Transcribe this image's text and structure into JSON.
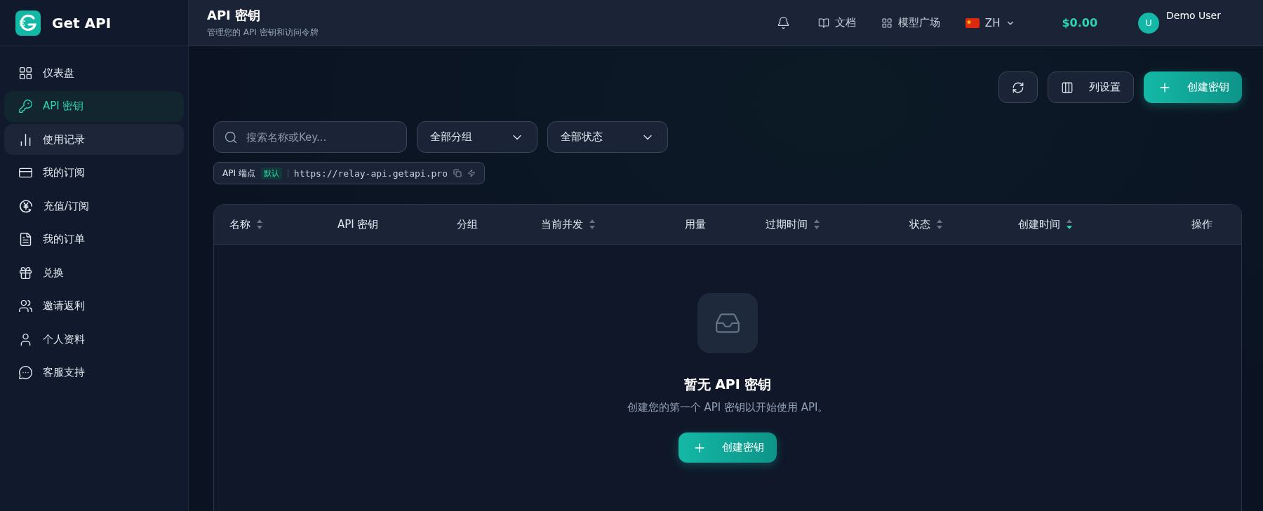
{
  "brand": {
    "name": "Get API"
  },
  "sidebar": {
    "items": [
      {
        "label": "仪表盘",
        "selected": false,
        "hovered": false
      },
      {
        "label": "API 密钥",
        "selected": true,
        "hovered": false
      },
      {
        "label": "使用记录",
        "selected": false,
        "hovered": true
      },
      {
        "label": "我的订阅",
        "selected": false,
        "hovered": false
      },
      {
        "label": "充值/订阅",
        "selected": false,
        "hovered": false
      },
      {
        "label": "我的订单",
        "selected": false,
        "hovered": false
      },
      {
        "label": "兑换",
        "selected": false,
        "hovered": false
      },
      {
        "label": "邀请返利",
        "selected": false,
        "hovered": false
      },
      {
        "label": "个人资料",
        "selected": false,
        "hovered": false
      },
      {
        "label": "客服支持",
        "selected": false,
        "hovered": false
      }
    ]
  },
  "header": {
    "title": "API 密钥",
    "subtitle": "管理您的 API 密钥和访问令牌",
    "links": [
      "文档",
      "模型广场"
    ],
    "language": "ZH",
    "balance": "$0.00",
    "user": {
      "initial": "U",
      "name": "Demo User"
    }
  },
  "toolbar": {
    "buttons": [
      {
        "kind": "refresh"
      },
      {
        "kind": "columns",
        "label": "列设置"
      },
      {
        "kind": "create",
        "label": "创建密钥"
      }
    ]
  },
  "filters": {
    "search": {
      "placeholder": "搜索名称或Key..."
    },
    "selects": [
      "全部分组",
      "全部状态"
    ]
  },
  "endpoint": {
    "label": "API 端点",
    "badge": "默认",
    "url": "https://relay-api.getapi.pro"
  },
  "table": {
    "columns": [
      {
        "label": "名称",
        "sortable": true,
        "sort_active": false
      },
      {
        "label": "API 密钥"
      },
      {
        "label": "分组"
      },
      {
        "label": "当前并发",
        "sortable": true,
        "sort_active": false
      },
      {
        "label": "用量"
      },
      {
        "label": "过期时间",
        "sortable": true,
        "sort_active": false
      },
      {
        "label": "状态",
        "sortable": true,
        "sort_active": false
      },
      {
        "label": "创建时间",
        "sortable": true,
        "sort_active": true
      },
      {
        "label": "操作"
      }
    ],
    "empty": {
      "title": "暂无 API 密钥",
      "message": "创建您的第一个 API 密钥以开始使用 API。",
      "button": "创建密钥"
    }
  }
}
